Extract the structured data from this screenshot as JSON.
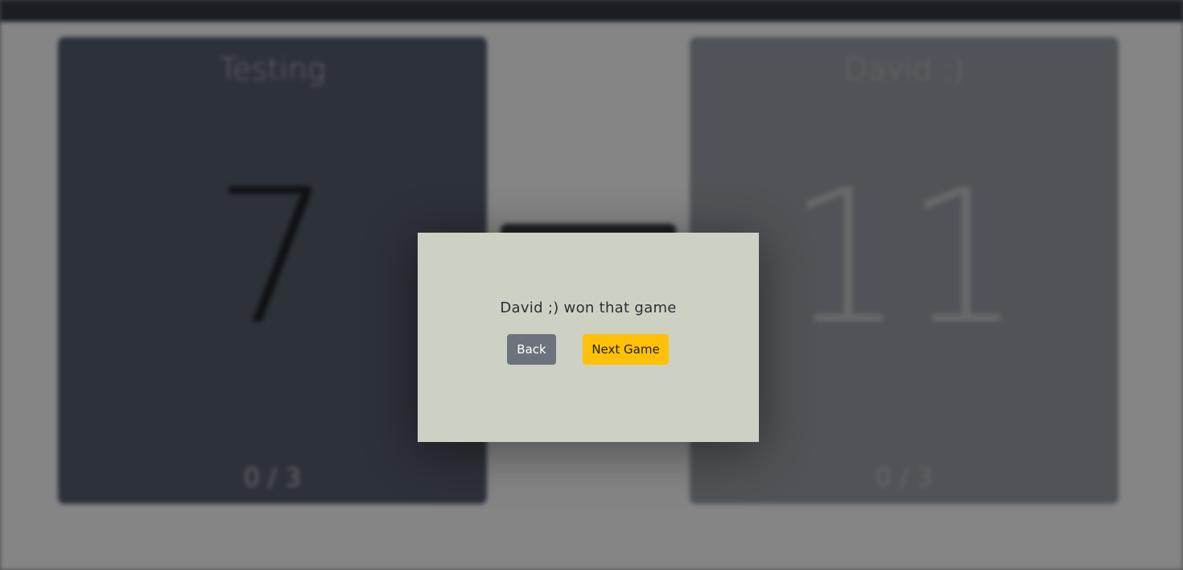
{
  "background": {
    "players": [
      {
        "name": "Testing",
        "score": "7",
        "sets": "0 / 3"
      },
      {
        "name": "David ;)",
        "score": "11",
        "sets": "0 / 3"
      }
    ]
  },
  "modal": {
    "message": "David ;) won that game",
    "back_label": "Back",
    "next_label": "Next Game"
  },
  "colors": {
    "modal_bg": "#cdd1c4",
    "back_button": "#6c737d",
    "next_button": "#ffc107",
    "left_card": "#565e6c",
    "right_card": "#9aa0a8"
  }
}
